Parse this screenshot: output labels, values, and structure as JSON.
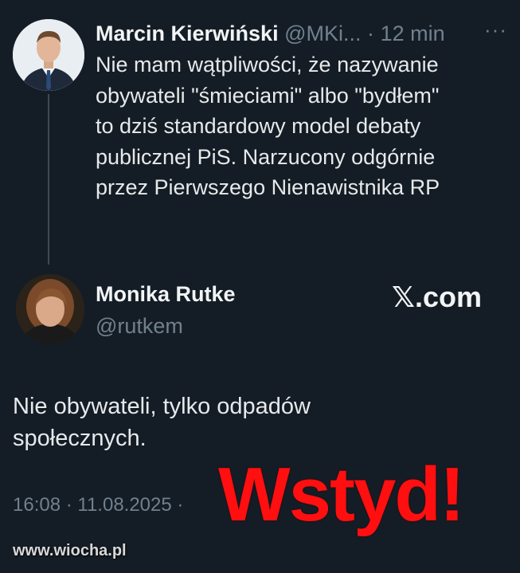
{
  "tweet_main": {
    "author_name": "Marcin Kierwiński",
    "author_handle": "@MKi...",
    "separator": "·",
    "time": "12 min",
    "more": "···",
    "text": "Nie mam wątpliwości, że nazywanie\nobywateli \"śmieciami\" albo \"bydłem\"\nto dziś  standardowy model debaty\npublicznej PiS. Narzucony odgórnie\nprzez Pierwszego Nienawistnika RP"
  },
  "tweet_reply": {
    "author_name": "Monika Rutke",
    "author_handle": "@rutkem",
    "brand": "𝕏.com",
    "text": "Nie obywateli, tylko odpadów\nspołecznych.",
    "timestamp": "16:08 · 11.08.2025 ·"
  },
  "overlay": {
    "stamp_text": "Wstyd!",
    "stamp_color": "#ff0f0f",
    "watermark": "www.wiocha.pl"
  },
  "colors": {
    "background": "#141d26",
    "text": "#e7e9ea",
    "muted": "#71808d"
  }
}
